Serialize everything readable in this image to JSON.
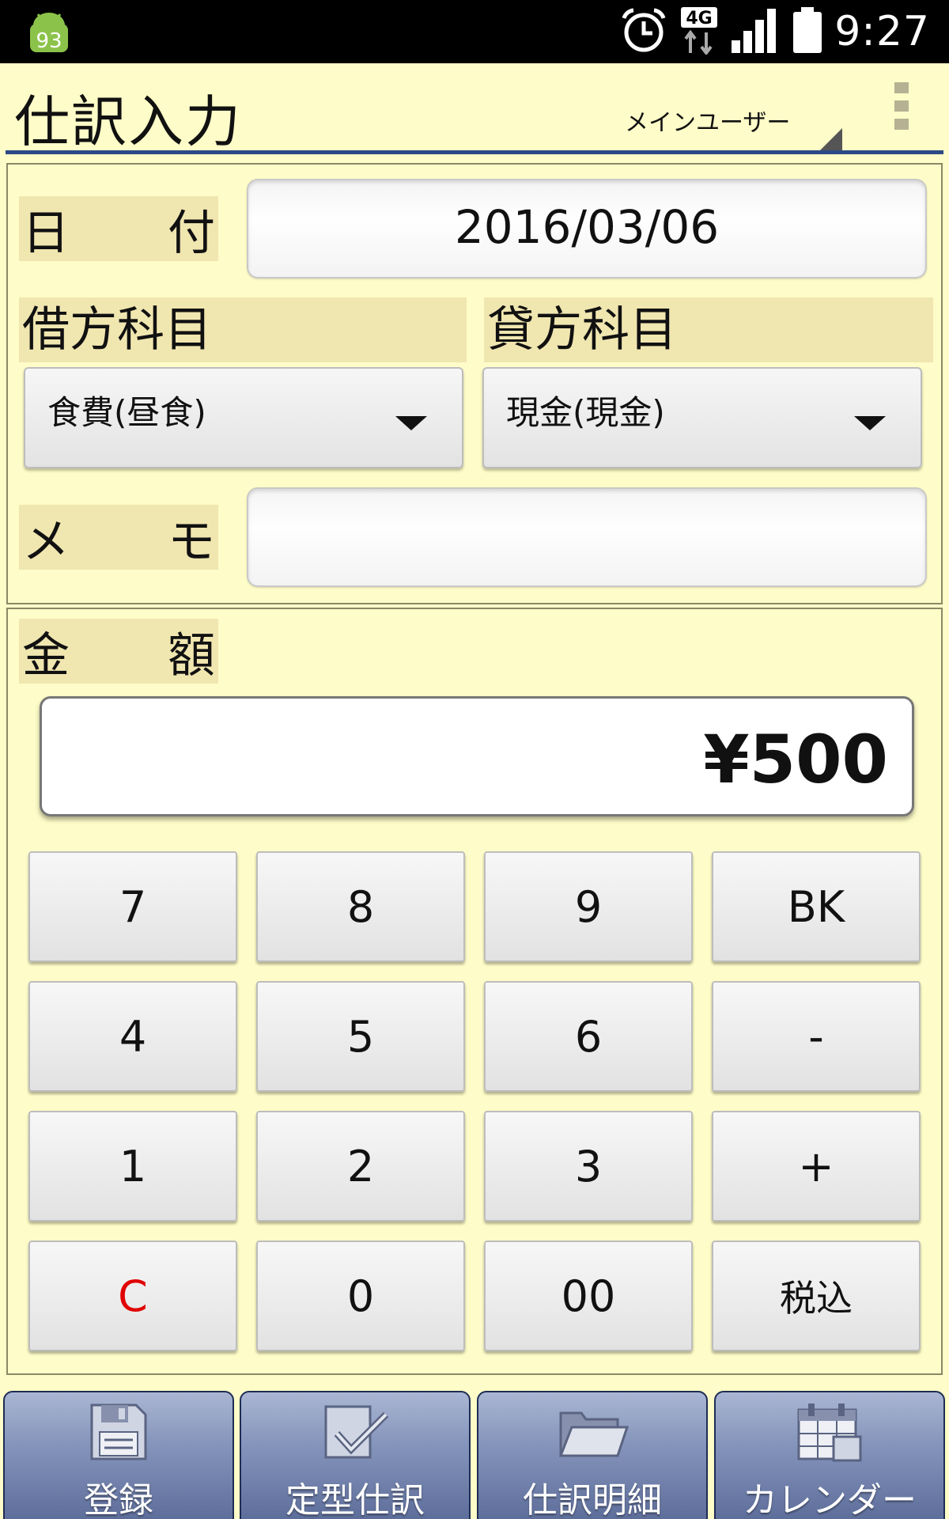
{
  "status_bar": {
    "notification_badge": "93",
    "network": "4G",
    "time": "9:27"
  },
  "app_bar": {
    "title": "仕訳入力",
    "user": "メインユーザー"
  },
  "form": {
    "date_label_a": "日",
    "date_label_b": "付",
    "date_value": "2016/03/06",
    "debit_label": "借方科目",
    "debit_value": "食費(昼食)",
    "credit_label": "貸方科目",
    "credit_value": "現金(現金)",
    "memo_label_a": "メ",
    "memo_label_b": "モ",
    "memo_value": ""
  },
  "amount": {
    "label_a": "金",
    "label_b": "額",
    "value": "¥500"
  },
  "keypad": {
    "k7": "7",
    "k8": "8",
    "k9": "9",
    "kbk": "BK",
    "k4": "4",
    "k5": "5",
    "k6": "6",
    "kminus": "-",
    "k1": "1",
    "k2": "2",
    "k3": "3",
    "kplus": "+",
    "kc": "C",
    "k0": "0",
    "k00": "00",
    "ktax": "税込"
  },
  "nav": {
    "register": "登録",
    "template": "定型仕訳",
    "detail": "仕訳明細",
    "calendar": "カレンダー"
  },
  "colors": {
    "background": "#fefcc8",
    "label_bg": "#f0e6b0",
    "accent_line": "#2d4a86",
    "clear_key": "#e00000",
    "nav_button": "#7d8db5"
  }
}
